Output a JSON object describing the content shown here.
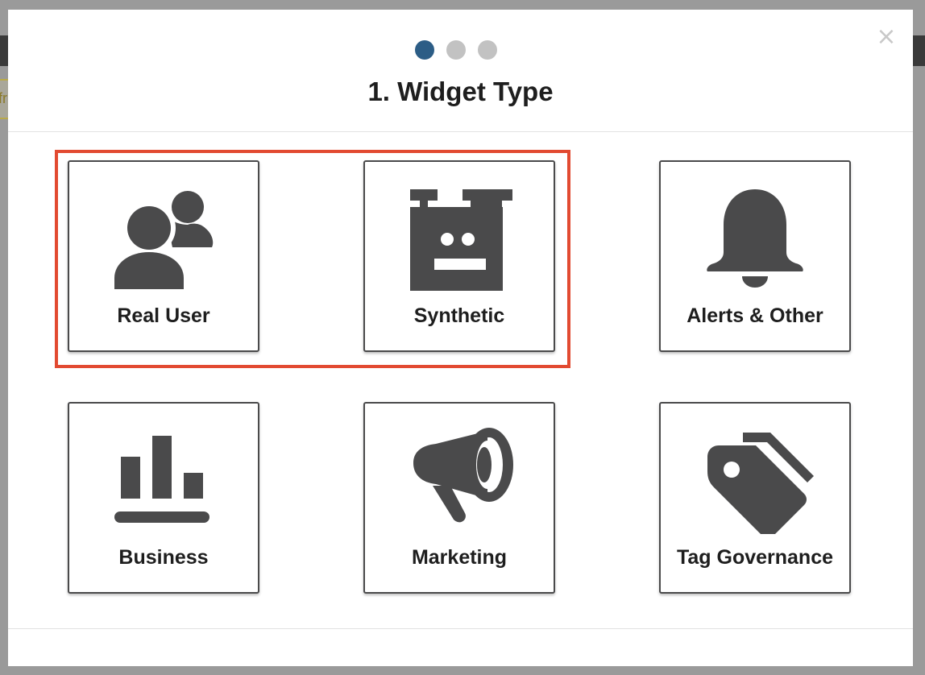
{
  "modal": {
    "title": "1. Widget Type",
    "close_glyph": "×",
    "steps": [
      {
        "state": "active"
      },
      {
        "state": "inactive"
      },
      {
        "state": "inactive"
      }
    ]
  },
  "background": {
    "fragment_text": "fr"
  },
  "tiles": [
    {
      "label": "Real User",
      "icon": "users-icon"
    },
    {
      "label": "Synthetic",
      "icon": "robot-icon"
    },
    {
      "label": "Alerts & Other",
      "icon": "bell-icon"
    },
    {
      "label": "Business",
      "icon": "bar-chart-icon"
    },
    {
      "label": "Marketing",
      "icon": "megaphone-icon"
    },
    {
      "label": "Tag Governance",
      "icon": "tags-icon"
    }
  ],
  "colors": {
    "accent_step": "#2c5d86",
    "step_inactive": "#c2c2c2",
    "highlight": "#e24a31",
    "icon": "#4a4a4b"
  }
}
